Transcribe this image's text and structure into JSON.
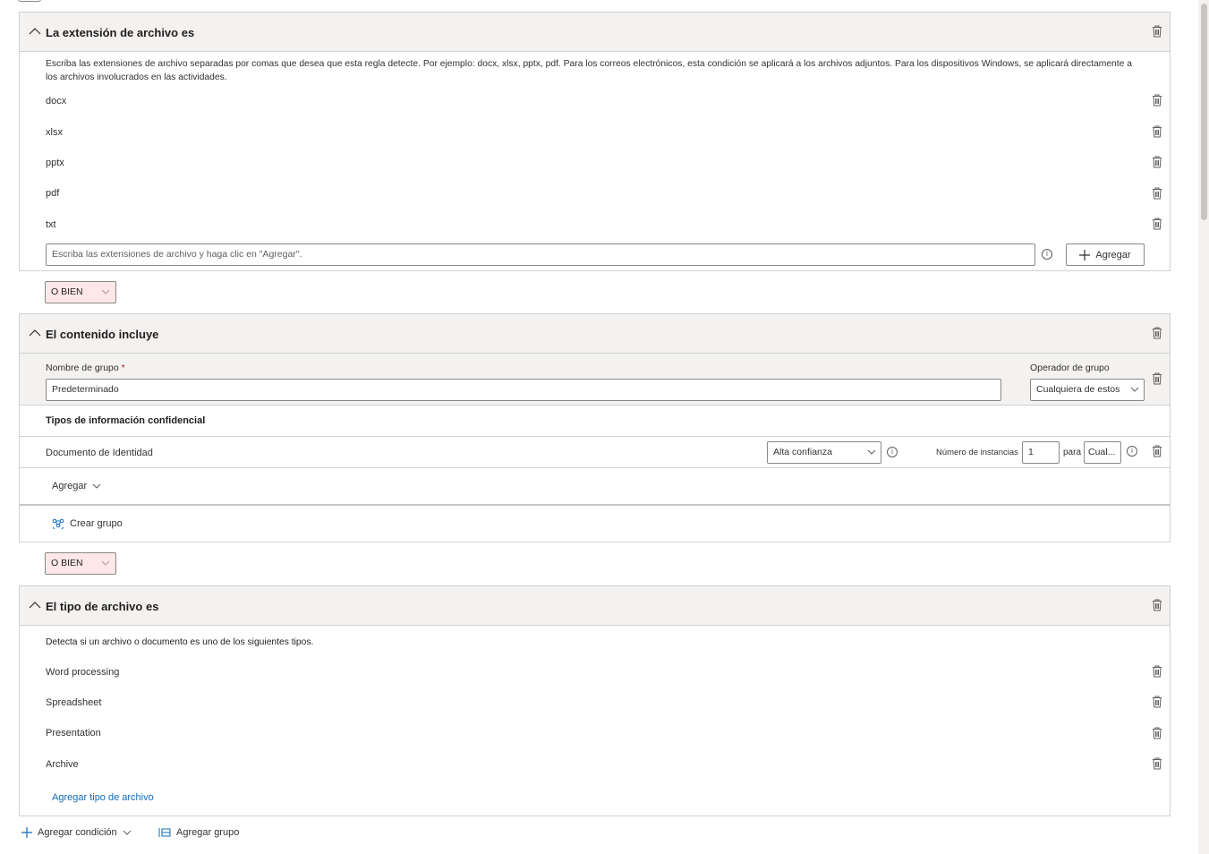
{
  "section1": {
    "title": "La extensión de archivo es",
    "description": "Escriba las extensiones de archivo separadas por comas que desea que esta regla detecte. Por ejemplo: docx, xlsx, pptx, pdf. Para los correos electrónicos, esta condición se aplicará a los archivos adjuntos. Para los dispositivos Windows, se aplicará directamente a los archivos involucrados en las actividades.",
    "extensions": [
      "docx",
      "xlsx",
      "pptx",
      "pdf",
      "txt"
    ],
    "input_placeholder": "Escriba las extensiones de archivo y haga clic en \"Agregar\".",
    "add_label": "Agregar"
  },
  "operator1": {
    "label": "O BIEN"
  },
  "section2": {
    "title": "El contenido incluye",
    "group_name_label": "Nombre de grupo",
    "required_mark": "*",
    "group_name_value": "Predeterminado",
    "group_operator_label": "Operador de grupo",
    "group_operator_value": "Cualquiera de estos",
    "sensitive_types_heading": "Tipos de información confidencial",
    "sensitive_type": {
      "name": "Documento de Identidad",
      "confidence": "Alta confianza",
      "instances_label": "Número de instancias",
      "instances_value": "1",
      "for_label": "para",
      "for_value": "Cual..."
    },
    "add_label": "Agregar",
    "create_group_label": "Crear grupo"
  },
  "operator2": {
    "label": "O BIEN"
  },
  "section3": {
    "title": "El tipo de archivo es",
    "description": "Detecta si un archivo o documento es uno de los siguientes tipos.",
    "file_types": [
      "Word processing",
      "Spreadsheet",
      "Presentation",
      "Archive"
    ],
    "add_file_type_label": "Agregar tipo de archivo"
  },
  "footer": {
    "add_condition_label": "Agregar condición",
    "add_group_label": "Agregar grupo"
  },
  "colors": {
    "accent": "#0f6cbd",
    "operator_bg": "#fde7e9",
    "header_bg": "#f3f2f1",
    "border": "#d1d1d1"
  }
}
